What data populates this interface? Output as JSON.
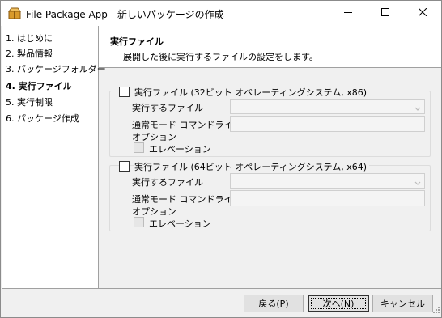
{
  "window": {
    "title": "File Package App - 新しいパッケージの作成",
    "icon": "package-app-icon",
    "controls": {
      "minimize": "minimize-icon",
      "maximize": "maximize-icon",
      "close": "close-icon"
    }
  },
  "sidebar": {
    "items": [
      {
        "label": "1. はじめに",
        "active": false
      },
      {
        "label": "2. 製品情報",
        "active": false
      },
      {
        "label": "3. パッケージフォルダー",
        "active": false
      },
      {
        "label": "4. 実行ファイル",
        "active": true
      },
      {
        "label": "5. 実行制限",
        "active": false
      },
      {
        "label": "6. パッケージ作成",
        "active": false
      }
    ]
  },
  "header": {
    "title": "実行ファイル",
    "description": "展開した後に実行するファイルの設定をします。"
  },
  "groups": [
    {
      "checkbox_label": "実行ファイル (32ビット オペレーティングシステム, x86)",
      "checked": false,
      "file_label": "実行するファイル",
      "file_value": "",
      "cmdline_label_line1": "通常モード コマンドライン",
      "cmdline_label_line2": "オプション",
      "cmdline_value": "",
      "elevation_label": "エレベーション",
      "elevation_checked": false
    },
    {
      "checkbox_label": "実行ファイル (64ビット オペレーティングシステム, x64)",
      "checked": false,
      "file_label": "実行するファイル",
      "file_value": "",
      "cmdline_label_line1": "通常モード コマンドライン",
      "cmdline_label_line2": "オプション",
      "cmdline_value": "",
      "elevation_label": "エレベーション",
      "elevation_checked": false
    }
  ],
  "footer": {
    "back_label": "戻る(P)",
    "next_label": "次へ(N)",
    "cancel_label": "キャンセル"
  },
  "colors": {
    "window_bg": "#f0f0f0",
    "panel_bg": "#ffffff",
    "disabled_field": "#f4f4f4",
    "border": "#a0a0a0"
  }
}
